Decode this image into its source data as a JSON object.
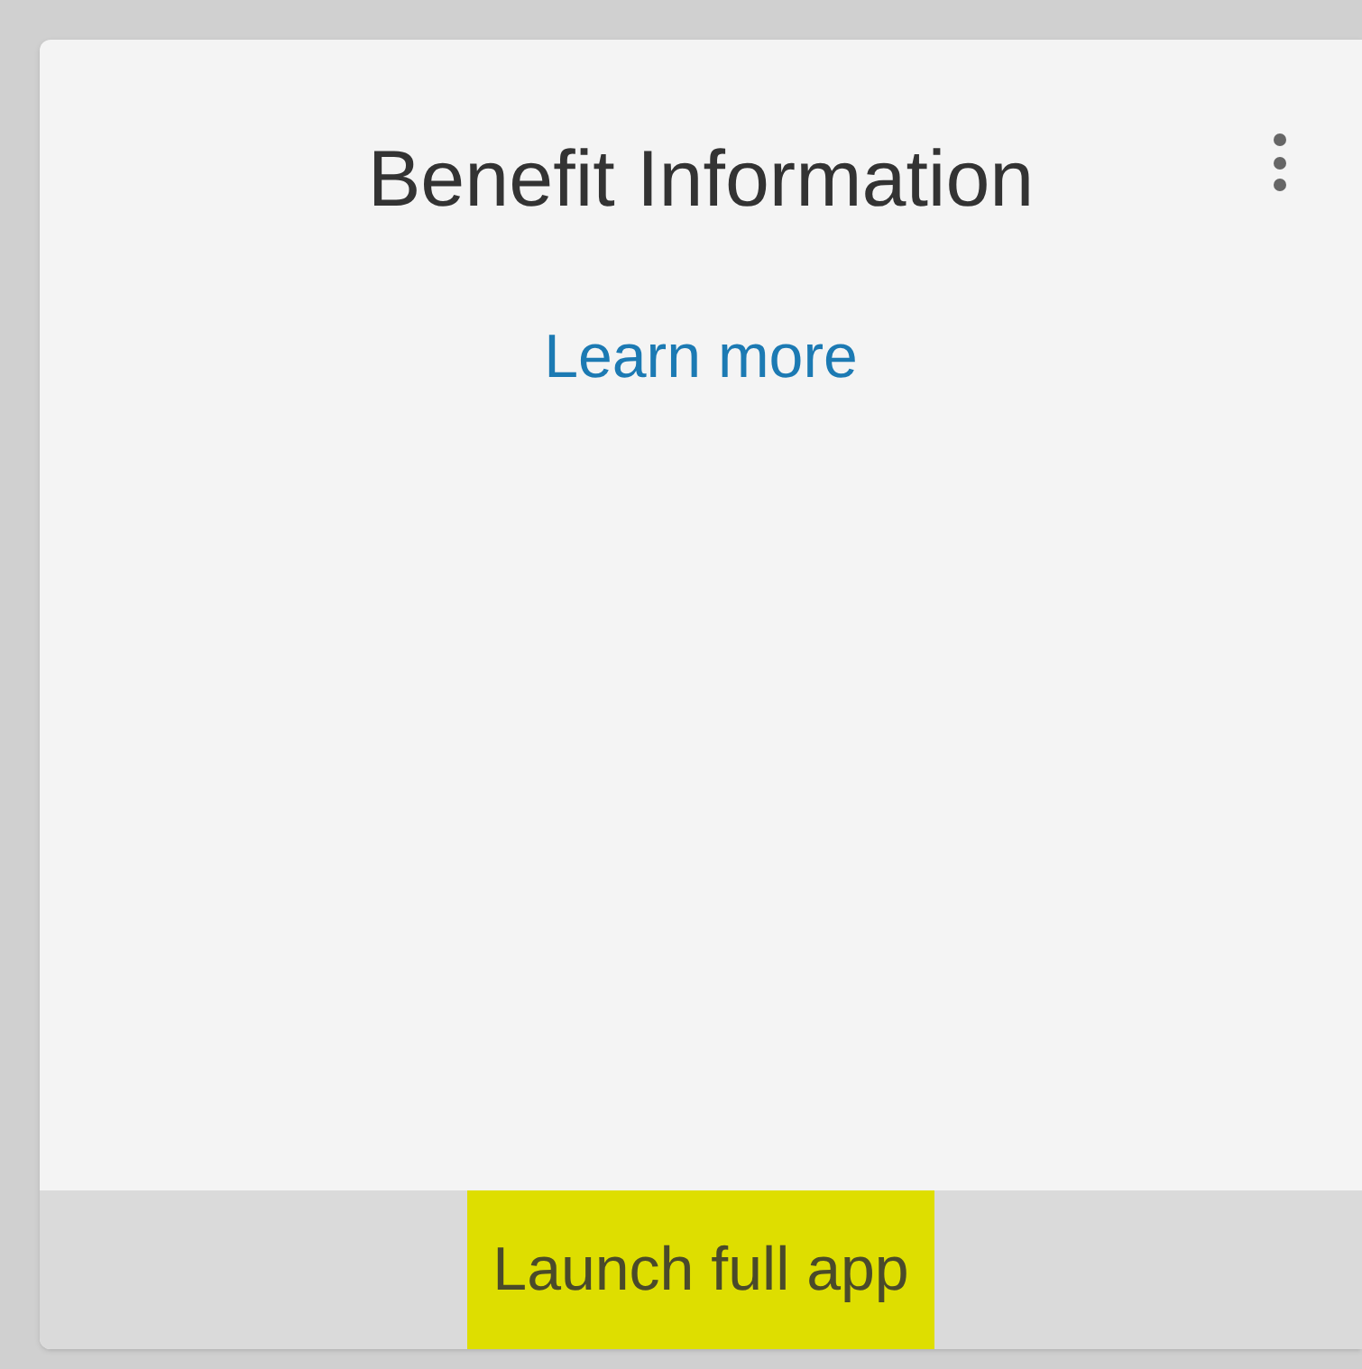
{
  "card": {
    "title": "Benefit Information",
    "link": "Learn more"
  },
  "footer": {
    "action": {
      "label": "Launch full app",
      "highlighted": true
    }
  }
}
